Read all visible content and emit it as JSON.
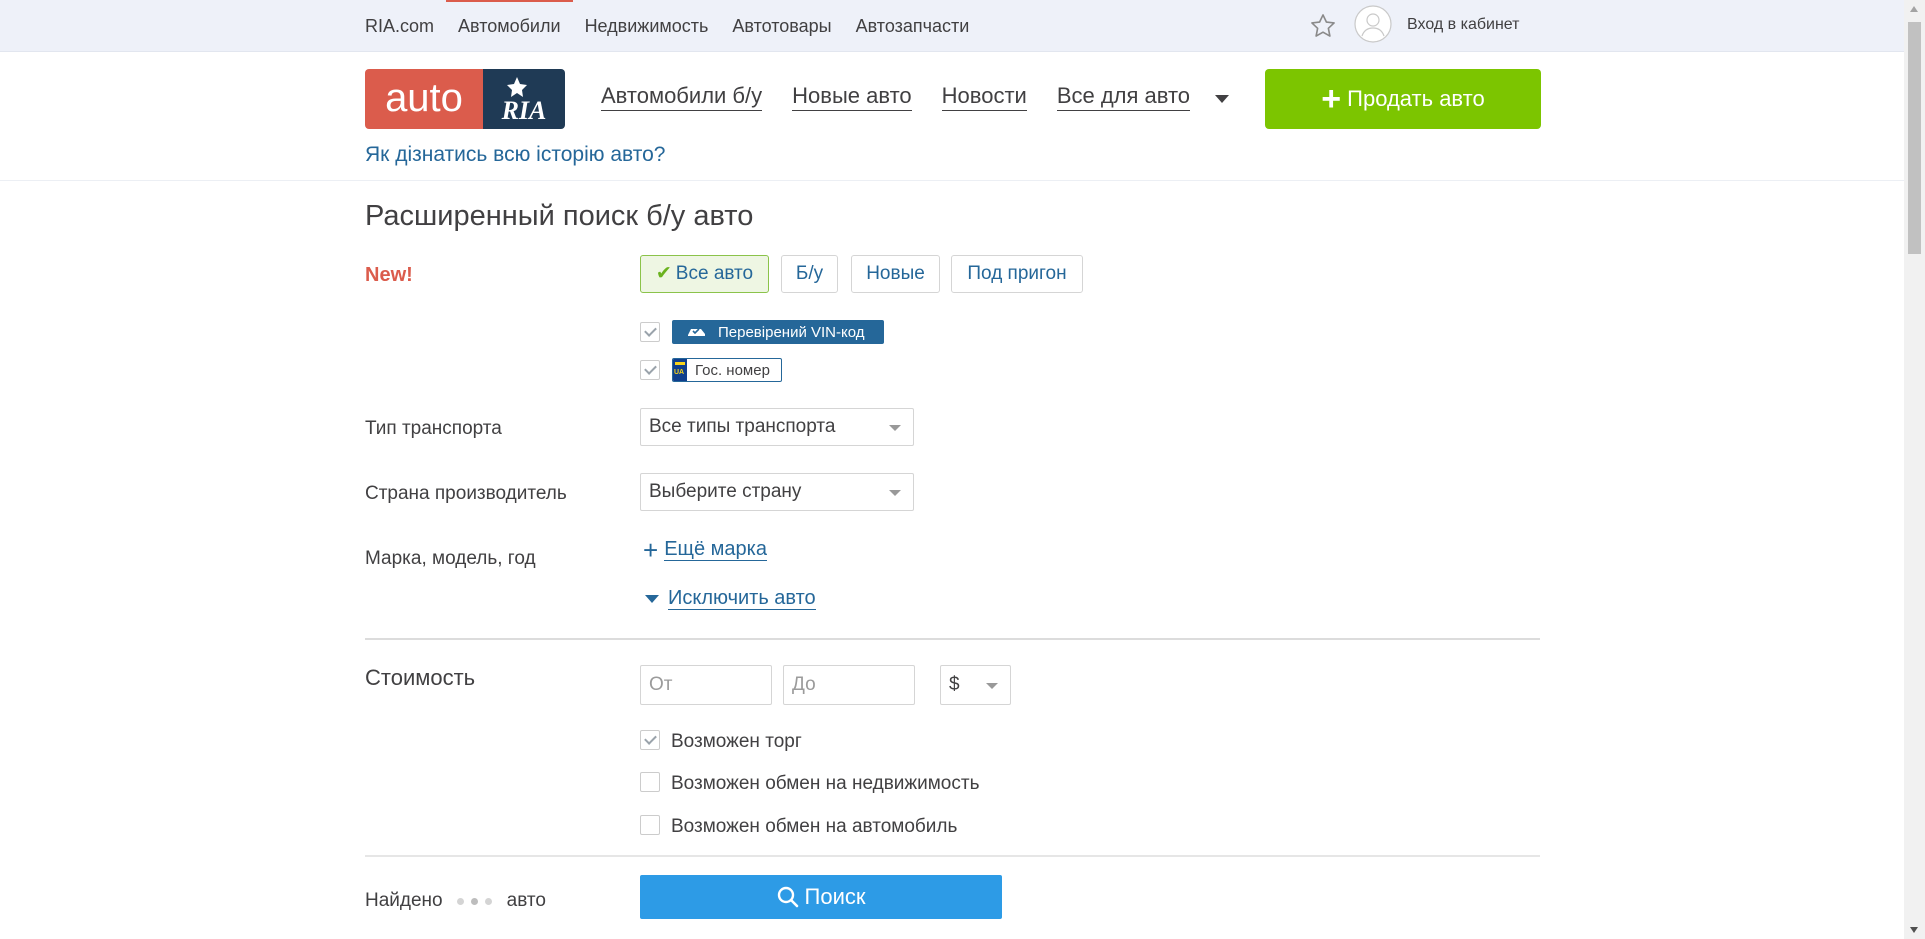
{
  "topbar": {
    "links": [
      {
        "label": "RIA.com"
      },
      {
        "label": "Автомобили"
      },
      {
        "label": "Недвижимость"
      },
      {
        "label": "Автотовары"
      },
      {
        "label": "Автозапчасти"
      }
    ],
    "login_label": "Вход в кабинет"
  },
  "header": {
    "logo_text": "auto",
    "logo_text_2": "RIA",
    "nav": [
      {
        "label": "Автомобили б/у"
      },
      {
        "label": "Новые авто"
      },
      {
        "label": "Новости"
      },
      {
        "label": "Все для авто"
      }
    ],
    "sell_label": "Продать авто",
    "history_link": "Як дізнатись всю історію авто?"
  },
  "page": {
    "title": "Расширенный поиск б/у авто",
    "new_label": "New!",
    "segments": [
      {
        "label": "Все авто",
        "active": true
      },
      {
        "label": "Б/у",
        "active": false
      },
      {
        "label": "Новые",
        "active": false
      },
      {
        "label": "Под пригон",
        "active": false
      }
    ],
    "vin_badge": "Перевірений VIN-код",
    "number_badge": "Гос. номер",
    "number_flag": "UA",
    "transport_label": "Тип транспорта",
    "transport_value": "Все типы транспорта",
    "country_label": "Страна производитель",
    "country_value": "Выберите страну",
    "brand_label": "Марка, модель, год",
    "add_brand": "Ещё марка",
    "exclude": "Исключить авто",
    "price_label": "Стоимость",
    "price_from_placeholder": "От",
    "price_to_placeholder": "До",
    "currency": "$",
    "options": [
      {
        "label": "Возможен торг",
        "checked": true
      },
      {
        "label": "Возможен обмен на недвижимость",
        "checked": false
      },
      {
        "label": "Возможен обмен на автомобиль",
        "checked": false
      }
    ]
  },
  "footer": {
    "found_prefix": "Найдено",
    "found_suffix": "авто",
    "search_label": "Поиск"
  },
  "colors": {
    "brand_red": "#db5c4c",
    "brand_dark": "#1f3a55",
    "sell_green": "#7cc500",
    "link_blue": "#256799",
    "search_blue": "#2d9be6"
  }
}
